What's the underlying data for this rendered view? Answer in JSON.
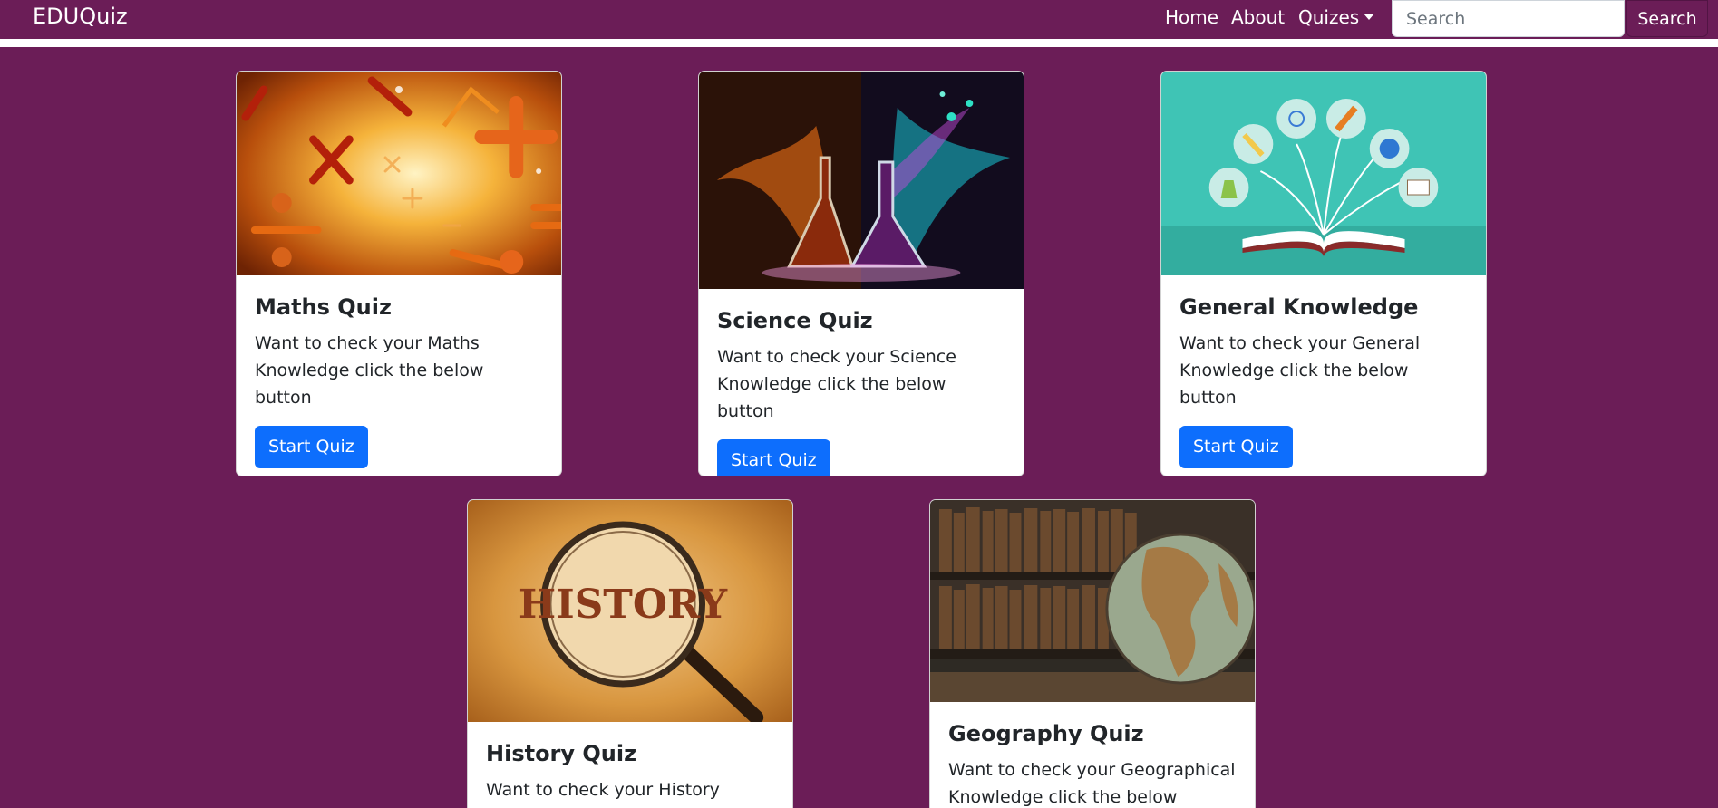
{
  "nav": {
    "brand": "EDUQuiz",
    "home": "Home",
    "about": "About",
    "quizes": "Quizes",
    "search_placeholder": "Search",
    "search_button": "Search"
  },
  "cards": [
    {
      "title": "Maths Quiz",
      "text": "Want to check your Maths Knowledge click the below button",
      "button": "Start Quiz"
    },
    {
      "title": "Science Quiz",
      "text": "Want to check your Science Knowledge click the below button",
      "button": "Start Quiz"
    },
    {
      "title": "General Knowledge",
      "text": "Want to check your General Knowledge click the below button",
      "button": "Start Quiz"
    },
    {
      "title": "History Quiz",
      "text": "Want to check your History",
      "button": ""
    },
    {
      "title": "Geography Quiz",
      "text": "Want to check your Geographical Knowledge click the below button",
      "button": ""
    }
  ],
  "image_labels": {
    "history": "HISTORY"
  },
  "colors": {
    "page_bg": "#6b1d57",
    "primary_button": "#0d6efd"
  }
}
